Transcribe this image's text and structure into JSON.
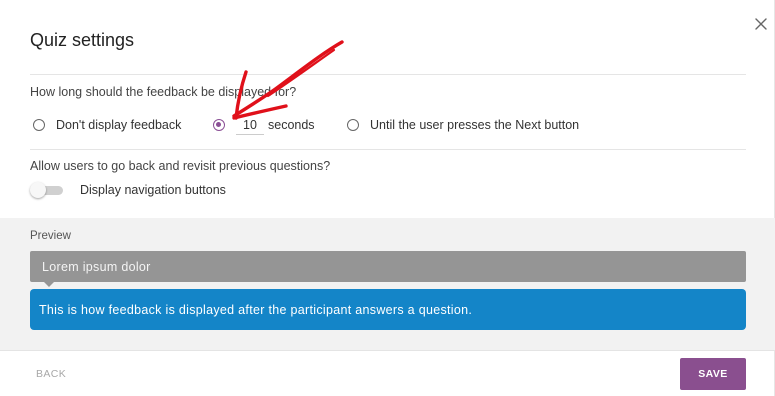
{
  "dialog": {
    "title": "Quiz settings",
    "close_icon": "close-icon"
  },
  "feedback_duration": {
    "question": "How long should the feedback be displayed for?",
    "options": [
      {
        "label": "Don't display feedback",
        "checked": false
      },
      {
        "value": "10",
        "suffix": "seconds",
        "checked": true
      },
      {
        "label": "Until the user presses the Next button",
        "checked": false
      }
    ]
  },
  "navigation": {
    "question": "Allow users to go back and revisit previous questions?",
    "toggle_label": "Display navigation buttons",
    "toggle_on": false
  },
  "preview": {
    "label": "Preview",
    "title_text": "Lorem ipsum dolor",
    "feedback_text": "This is how feedback is displayed after the participant answers a question."
  },
  "footer": {
    "back_label": "BACK",
    "save_label": "SAVE"
  },
  "colors": {
    "accent": "#8a4f8f",
    "feedback_blue": "#1485c8",
    "preview_gray": "#959595",
    "annotation_red": "#e0101a"
  }
}
